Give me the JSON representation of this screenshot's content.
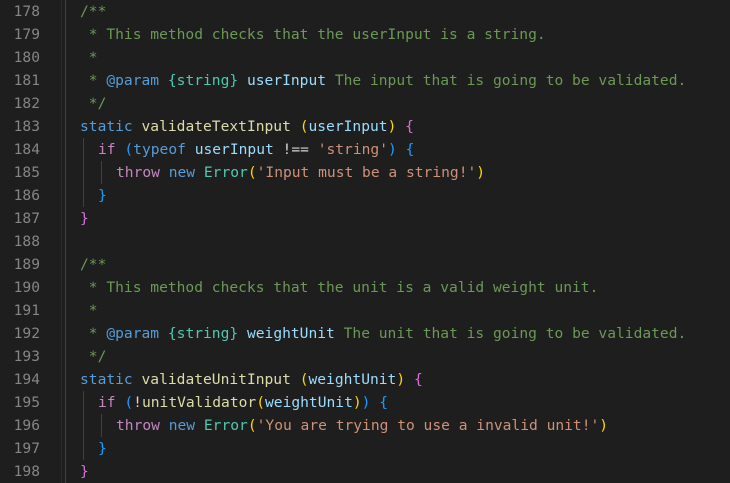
{
  "editor": {
    "language": "javascript",
    "lines": [
      {
        "n": "178",
        "indent": 1,
        "tokens": [
          {
            "t": "/**",
            "c": "cmt"
          }
        ]
      },
      {
        "n": "179",
        "indent": 1,
        "tokens": [
          {
            "t": " * This method checks that the userInput is a string.",
            "c": "cmt"
          }
        ]
      },
      {
        "n": "180",
        "indent": 1,
        "tokens": [
          {
            "t": " *",
            "c": "cmt"
          }
        ]
      },
      {
        "n": "181",
        "indent": 1,
        "tokens": [
          {
            "t": " * ",
            "c": "cmt"
          },
          {
            "t": "@param",
            "c": "kw"
          },
          {
            "t": " ",
            "c": "cmt"
          },
          {
            "t": "{string}",
            "c": "cls"
          },
          {
            "t": " ",
            "c": "cmt"
          },
          {
            "t": "userInput",
            "c": "var"
          },
          {
            "t": " The input that is going to be validated.",
            "c": "cmt"
          }
        ]
      },
      {
        "n": "182",
        "indent": 1,
        "tokens": [
          {
            "t": " */",
            "c": "cmt"
          }
        ]
      },
      {
        "n": "183",
        "indent": 1,
        "tokens": [
          {
            "t": "static",
            "c": "kw"
          },
          {
            "t": " ",
            "c": "op"
          },
          {
            "t": "validateTextInput",
            "c": "fn"
          },
          {
            "t": " ",
            "c": "op"
          },
          {
            "t": "(",
            "c": "br3"
          },
          {
            "t": "userInput",
            "c": "var"
          },
          {
            "t": ")",
            "c": "br3"
          },
          {
            "t": " ",
            "c": "op"
          },
          {
            "t": "{",
            "c": "br1"
          }
        ]
      },
      {
        "n": "184",
        "indent": 2,
        "tokens": [
          {
            "t": "if",
            "c": "ctl"
          },
          {
            "t": " ",
            "c": "op"
          },
          {
            "t": "(",
            "c": "br2"
          },
          {
            "t": "typeof",
            "c": "kw"
          },
          {
            "t": " ",
            "c": "op"
          },
          {
            "t": "userInput",
            "c": "var"
          },
          {
            "t": " !== ",
            "c": "op"
          },
          {
            "t": "'string'",
            "c": "str"
          },
          {
            "t": ")",
            "c": "br2"
          },
          {
            "t": " ",
            "c": "op"
          },
          {
            "t": "{",
            "c": "br2"
          }
        ]
      },
      {
        "n": "185",
        "indent": 3,
        "tokens": [
          {
            "t": "throw",
            "c": "ctl"
          },
          {
            "t": " ",
            "c": "op"
          },
          {
            "t": "new",
            "c": "kw"
          },
          {
            "t": " ",
            "c": "op"
          },
          {
            "t": "Error",
            "c": "cls"
          },
          {
            "t": "(",
            "c": "br3"
          },
          {
            "t": "'Input must be a string!'",
            "c": "str"
          },
          {
            "t": ")",
            "c": "br3"
          }
        ]
      },
      {
        "n": "186",
        "indent": 2,
        "tokens": [
          {
            "t": "}",
            "c": "br2"
          }
        ]
      },
      {
        "n": "187",
        "indent": 1,
        "tokens": [
          {
            "t": "}",
            "c": "br1"
          }
        ]
      },
      {
        "n": "188",
        "indent": 0,
        "tokens": []
      },
      {
        "n": "189",
        "indent": 1,
        "tokens": [
          {
            "t": "/**",
            "c": "cmt"
          }
        ]
      },
      {
        "n": "190",
        "indent": 1,
        "tokens": [
          {
            "t": " * This method checks that the unit is a valid weight unit.",
            "c": "cmt"
          }
        ]
      },
      {
        "n": "191",
        "indent": 1,
        "tokens": [
          {
            "t": " *",
            "c": "cmt"
          }
        ]
      },
      {
        "n": "192",
        "indent": 1,
        "tokens": [
          {
            "t": " * ",
            "c": "cmt"
          },
          {
            "t": "@param",
            "c": "kw"
          },
          {
            "t": " ",
            "c": "cmt"
          },
          {
            "t": "{string}",
            "c": "cls"
          },
          {
            "t": " ",
            "c": "cmt"
          },
          {
            "t": "weightUnit",
            "c": "var"
          },
          {
            "t": " The unit that is going to be validated.",
            "c": "cmt"
          }
        ]
      },
      {
        "n": "193",
        "indent": 1,
        "tokens": [
          {
            "t": " */",
            "c": "cmt"
          }
        ]
      },
      {
        "n": "194",
        "indent": 1,
        "tokens": [
          {
            "t": "static",
            "c": "kw"
          },
          {
            "t": " ",
            "c": "op"
          },
          {
            "t": "validateUnitInput",
            "c": "fn"
          },
          {
            "t": " ",
            "c": "op"
          },
          {
            "t": "(",
            "c": "br3"
          },
          {
            "t": "weightUnit",
            "c": "var"
          },
          {
            "t": ")",
            "c": "br3"
          },
          {
            "t": " ",
            "c": "op"
          },
          {
            "t": "{",
            "c": "br1"
          }
        ]
      },
      {
        "n": "195",
        "indent": 2,
        "tokens": [
          {
            "t": "if",
            "c": "ctl"
          },
          {
            "t": " ",
            "c": "op"
          },
          {
            "t": "(",
            "c": "br2"
          },
          {
            "t": "!",
            "c": "op"
          },
          {
            "t": "unitValidator",
            "c": "fn"
          },
          {
            "t": "(",
            "c": "br3"
          },
          {
            "t": "weightUnit",
            "c": "var"
          },
          {
            "t": ")",
            "c": "br3"
          },
          {
            "t": ")",
            "c": "br2"
          },
          {
            "t": " ",
            "c": "op"
          },
          {
            "t": "{",
            "c": "br2"
          }
        ]
      },
      {
        "n": "196",
        "indent": 3,
        "tokens": [
          {
            "t": "throw",
            "c": "ctl"
          },
          {
            "t": " ",
            "c": "op"
          },
          {
            "t": "new",
            "c": "kw"
          },
          {
            "t": " ",
            "c": "op"
          },
          {
            "t": "Error",
            "c": "cls"
          },
          {
            "t": "(",
            "c": "br3"
          },
          {
            "t": "'You are trying to use a invalid unit!'",
            "c": "str"
          },
          {
            "t": ")",
            "c": "br3"
          }
        ]
      },
      {
        "n": "197",
        "indent": 2,
        "tokens": [
          {
            "t": "}",
            "c": "br2"
          }
        ]
      },
      {
        "n": "198",
        "indent": 1,
        "tokens": [
          {
            "t": "}",
            "c": "br1"
          }
        ]
      }
    ]
  },
  "colors": {
    "background": "#1e1e1e",
    "line_number": "#858585",
    "comment": "#6a9955",
    "keyword": "#569cd6",
    "control": "#c586c0",
    "function": "#dcdcaa",
    "variable": "#9cdcfe",
    "string": "#ce9178",
    "class": "#4ec9b0"
  }
}
